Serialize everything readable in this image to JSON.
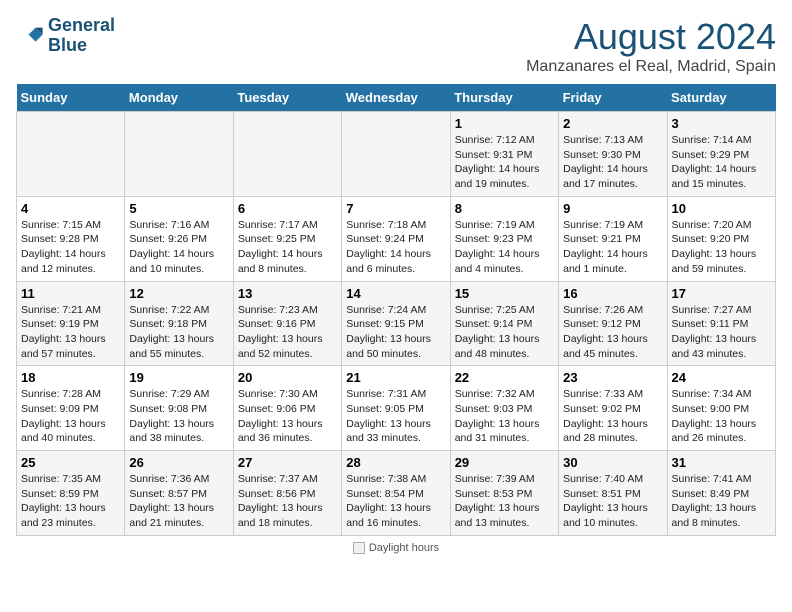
{
  "header": {
    "logo_line1": "General",
    "logo_line2": "Blue",
    "title": "August 2024",
    "subtitle": "Manzanares el Real, Madrid, Spain"
  },
  "days_of_week": [
    "Sunday",
    "Monday",
    "Tuesday",
    "Wednesday",
    "Thursday",
    "Friday",
    "Saturday"
  ],
  "weeks": [
    [
      {
        "day": "",
        "info": ""
      },
      {
        "day": "",
        "info": ""
      },
      {
        "day": "",
        "info": ""
      },
      {
        "day": "",
        "info": ""
      },
      {
        "day": "1",
        "info": "Sunrise: 7:12 AM\nSunset: 9:31 PM\nDaylight: 14 hours and 19 minutes."
      },
      {
        "day": "2",
        "info": "Sunrise: 7:13 AM\nSunset: 9:30 PM\nDaylight: 14 hours and 17 minutes."
      },
      {
        "day": "3",
        "info": "Sunrise: 7:14 AM\nSunset: 9:29 PM\nDaylight: 14 hours and 15 minutes."
      }
    ],
    [
      {
        "day": "4",
        "info": "Sunrise: 7:15 AM\nSunset: 9:28 PM\nDaylight: 14 hours and 12 minutes."
      },
      {
        "day": "5",
        "info": "Sunrise: 7:16 AM\nSunset: 9:26 PM\nDaylight: 14 hours and 10 minutes."
      },
      {
        "day": "6",
        "info": "Sunrise: 7:17 AM\nSunset: 9:25 PM\nDaylight: 14 hours and 8 minutes."
      },
      {
        "day": "7",
        "info": "Sunrise: 7:18 AM\nSunset: 9:24 PM\nDaylight: 14 hours and 6 minutes."
      },
      {
        "day": "8",
        "info": "Sunrise: 7:19 AM\nSunset: 9:23 PM\nDaylight: 14 hours and 4 minutes."
      },
      {
        "day": "9",
        "info": "Sunrise: 7:19 AM\nSunset: 9:21 PM\nDaylight: 14 hours and 1 minute."
      },
      {
        "day": "10",
        "info": "Sunrise: 7:20 AM\nSunset: 9:20 PM\nDaylight: 13 hours and 59 minutes."
      }
    ],
    [
      {
        "day": "11",
        "info": "Sunrise: 7:21 AM\nSunset: 9:19 PM\nDaylight: 13 hours and 57 minutes."
      },
      {
        "day": "12",
        "info": "Sunrise: 7:22 AM\nSunset: 9:18 PM\nDaylight: 13 hours and 55 minutes."
      },
      {
        "day": "13",
        "info": "Sunrise: 7:23 AM\nSunset: 9:16 PM\nDaylight: 13 hours and 52 minutes."
      },
      {
        "day": "14",
        "info": "Sunrise: 7:24 AM\nSunset: 9:15 PM\nDaylight: 13 hours and 50 minutes."
      },
      {
        "day": "15",
        "info": "Sunrise: 7:25 AM\nSunset: 9:14 PM\nDaylight: 13 hours and 48 minutes."
      },
      {
        "day": "16",
        "info": "Sunrise: 7:26 AM\nSunset: 9:12 PM\nDaylight: 13 hours and 45 minutes."
      },
      {
        "day": "17",
        "info": "Sunrise: 7:27 AM\nSunset: 9:11 PM\nDaylight: 13 hours and 43 minutes."
      }
    ],
    [
      {
        "day": "18",
        "info": "Sunrise: 7:28 AM\nSunset: 9:09 PM\nDaylight: 13 hours and 40 minutes."
      },
      {
        "day": "19",
        "info": "Sunrise: 7:29 AM\nSunset: 9:08 PM\nDaylight: 13 hours and 38 minutes."
      },
      {
        "day": "20",
        "info": "Sunrise: 7:30 AM\nSunset: 9:06 PM\nDaylight: 13 hours and 36 minutes."
      },
      {
        "day": "21",
        "info": "Sunrise: 7:31 AM\nSunset: 9:05 PM\nDaylight: 13 hours and 33 minutes."
      },
      {
        "day": "22",
        "info": "Sunrise: 7:32 AM\nSunset: 9:03 PM\nDaylight: 13 hours and 31 minutes."
      },
      {
        "day": "23",
        "info": "Sunrise: 7:33 AM\nSunset: 9:02 PM\nDaylight: 13 hours and 28 minutes."
      },
      {
        "day": "24",
        "info": "Sunrise: 7:34 AM\nSunset: 9:00 PM\nDaylight: 13 hours and 26 minutes."
      }
    ],
    [
      {
        "day": "25",
        "info": "Sunrise: 7:35 AM\nSunset: 8:59 PM\nDaylight: 13 hours and 23 minutes."
      },
      {
        "day": "26",
        "info": "Sunrise: 7:36 AM\nSunset: 8:57 PM\nDaylight: 13 hours and 21 minutes."
      },
      {
        "day": "27",
        "info": "Sunrise: 7:37 AM\nSunset: 8:56 PM\nDaylight: 13 hours and 18 minutes."
      },
      {
        "day": "28",
        "info": "Sunrise: 7:38 AM\nSunset: 8:54 PM\nDaylight: 13 hours and 16 minutes."
      },
      {
        "day": "29",
        "info": "Sunrise: 7:39 AM\nSunset: 8:53 PM\nDaylight: 13 hours and 13 minutes."
      },
      {
        "day": "30",
        "info": "Sunrise: 7:40 AM\nSunset: 8:51 PM\nDaylight: 13 hours and 10 minutes."
      },
      {
        "day": "31",
        "info": "Sunrise: 7:41 AM\nSunset: 8:49 PM\nDaylight: 13 hours and 8 minutes."
      }
    ]
  ],
  "footer": {
    "daylight_label": "Daylight hours"
  }
}
